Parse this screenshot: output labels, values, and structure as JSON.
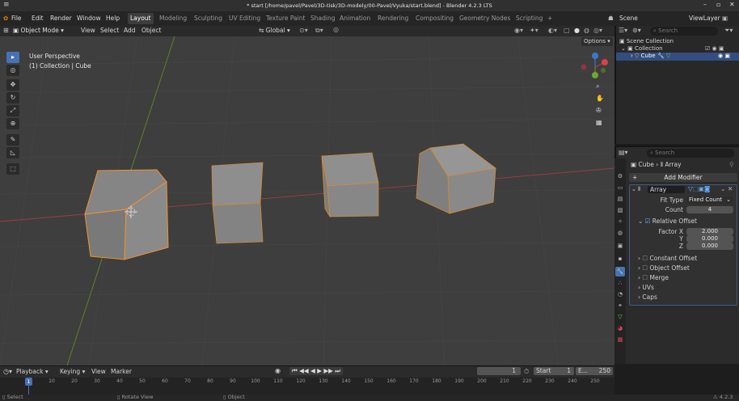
{
  "window": {
    "title": "* start [/home/pavel/Pavel/3D-tisk/3D-modely/00-Pavel/Vyuka/start.blend] - Blender 4.2.3 LTS",
    "minimize": "–",
    "maximize": "▫",
    "close": "✕"
  },
  "menu": {
    "file": "File",
    "edit": "Edit",
    "render": "Render",
    "window": "Window",
    "help": "Help"
  },
  "workspaces": [
    "Layout",
    "Modeling",
    "Sculpting",
    "UV Editing",
    "Texture Paint",
    "Shading",
    "Animation",
    "Rendering",
    "Compositing",
    "Geometry Nodes",
    "Scripting",
    "+"
  ],
  "scene": {
    "label": "Scene",
    "viewlayer": "ViewLayer"
  },
  "viewport_header": {
    "mode": "Object Mode",
    "view": "View",
    "select": "Select",
    "add": "Add",
    "object": "Object",
    "orientation": "Global",
    "options": "Options"
  },
  "viewport": {
    "perspective": "User Perspective",
    "collection_info": "(1) Collection | Cube"
  },
  "gizmo": {
    "x": "X",
    "y": "Y",
    "z": "Z"
  },
  "outliner": {
    "search_placeholder": "Search",
    "scene_collection": "Scene Collection",
    "collection": "Collection",
    "cube": "Cube"
  },
  "properties": {
    "search_placeholder": "Search",
    "breadcrumb_object": "Cube",
    "breadcrumb_modifier": "Array",
    "add_modifier": "Add Modifier",
    "modifier_name": "Array",
    "fit_type_label": "Fit Type",
    "fit_type_value": "Fixed Count",
    "count_label": "Count",
    "count_value": "4",
    "relative_offset": "Relative Offset",
    "factor_x_label": "Factor X",
    "factor_x": "2.000",
    "y_label": "Y",
    "factor_y": "0.000",
    "z_label": "Z",
    "factor_z": "0.000",
    "constant_offset": "Constant Offset",
    "object_offset": "Object Offset",
    "merge": "Merge",
    "uvs": "UVs",
    "caps": "Caps"
  },
  "timeline": {
    "playback": "Playback",
    "keying": "Keying",
    "view": "View",
    "marker": "Marker",
    "current_frame": "1",
    "start_label": "Start",
    "start_value": "1",
    "end_label": "E...",
    "end_value": "250",
    "ticks": [
      "1",
      "10",
      "20",
      "30",
      "40",
      "50",
      "60",
      "70",
      "80",
      "90",
      "100",
      "110",
      "120",
      "130",
      "140",
      "150",
      "160",
      "170",
      "180",
      "190",
      "200",
      "210",
      "220",
      "230",
      "240",
      "250"
    ]
  },
  "status": {
    "select": "Select",
    "rotate": "Rotate View",
    "object": "Object",
    "version": "4.2.3"
  }
}
